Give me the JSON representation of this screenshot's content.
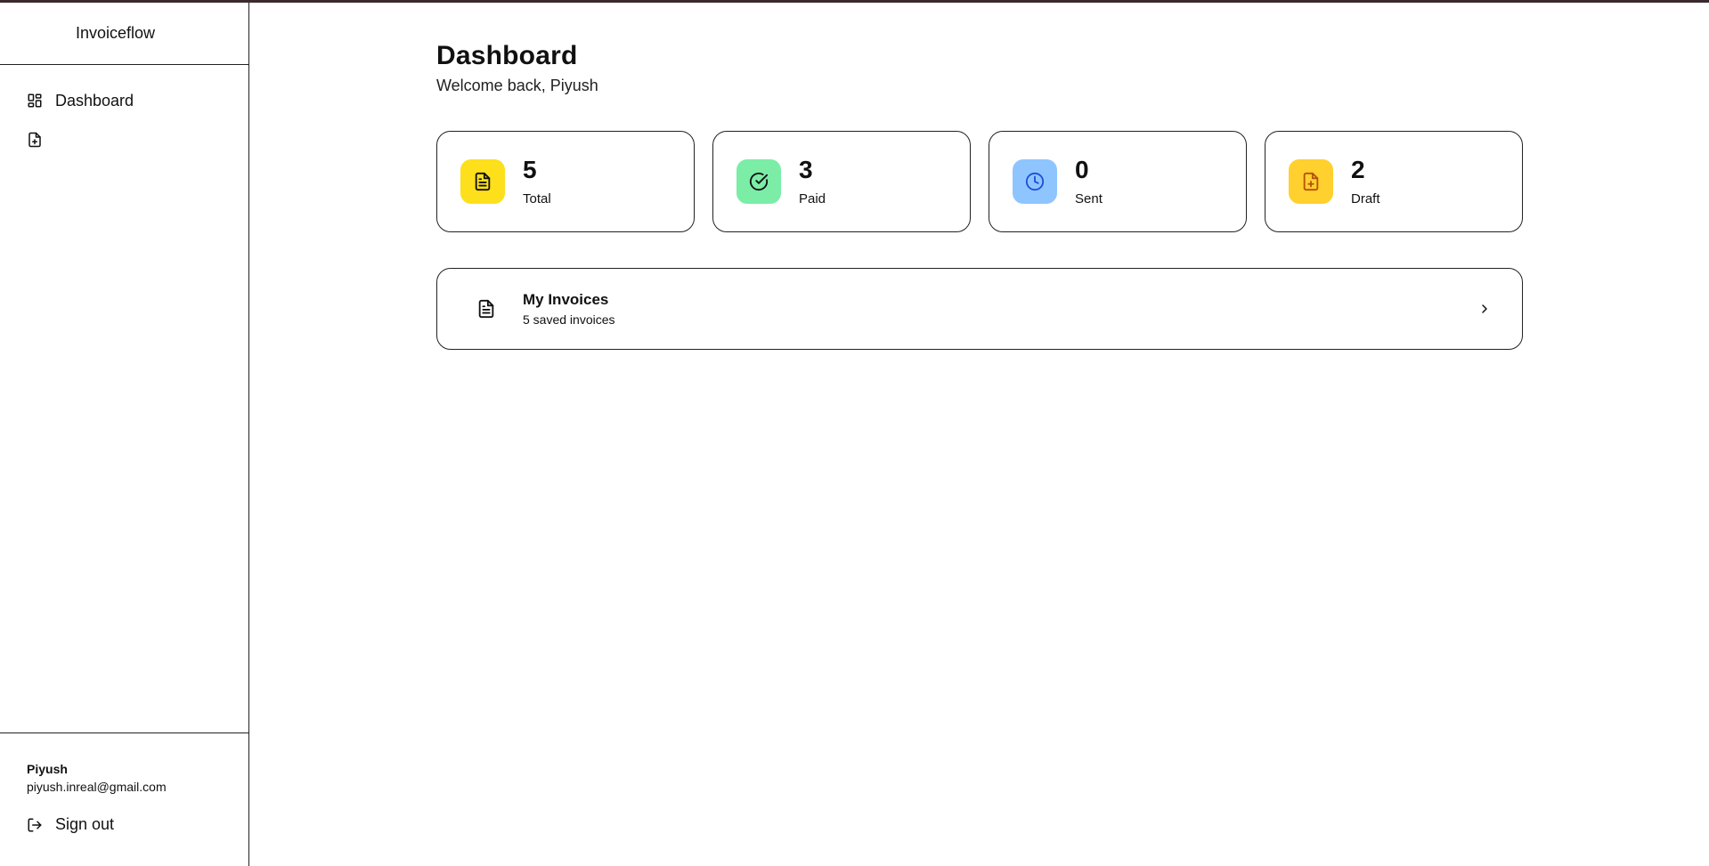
{
  "sidebar": {
    "brand": "Invoiceflow",
    "items": [
      {
        "label": "Dashboard",
        "icon": "layout-grid-icon"
      },
      {
        "label": "",
        "icon": "file-plus-icon"
      }
    ],
    "user": {
      "name": "Piyush",
      "email": "piyush.inreal@gmail.com"
    },
    "signout_label": "Sign out"
  },
  "main": {
    "title": "Dashboard",
    "welcome": "Welcome back, Piyush",
    "stats": [
      {
        "value": "5",
        "label": "Total",
        "icon": "file-text-icon",
        "color": "#FDDF1B"
      },
      {
        "value": "3",
        "label": "Paid",
        "icon": "check-circle-icon",
        "color": "#7BEDA7"
      },
      {
        "value": "0",
        "label": "Sent",
        "icon": "clock-icon",
        "color": "#8EC5FF"
      },
      {
        "value": "2",
        "label": "Draft",
        "icon": "file-plus-icon",
        "color": "#FFD02E"
      }
    ],
    "invoices_card": {
      "title": "My Invoices",
      "subtitle": "5 saved invoices"
    }
  }
}
